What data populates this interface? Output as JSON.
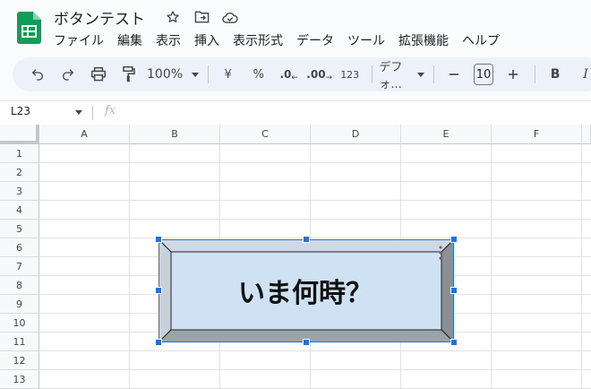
{
  "app": {
    "doc_title": "ボタンテスト",
    "menu": [
      "ファイル",
      "編集",
      "表示",
      "挿入",
      "表示形式",
      "データ",
      "ツール",
      "拡張機能",
      "ヘルプ"
    ]
  },
  "toolbar": {
    "zoom": "100%",
    "currency": "¥",
    "percent": "%",
    "decrease_decimal": ".0",
    "increase_decimal": ".00",
    "number_format": "123",
    "font": "デフォ...",
    "font_size": "10",
    "bold": "B",
    "italic": "I"
  },
  "formula_bar": {
    "name_box": "L23",
    "fx": "fx"
  },
  "grid": {
    "columns": [
      "A",
      "B",
      "C",
      "D",
      "E",
      "F"
    ],
    "rows": [
      "1",
      "2",
      "3",
      "4",
      "5",
      "6",
      "7",
      "8",
      "9",
      "10",
      "11",
      "12",
      "13"
    ]
  },
  "drawing": {
    "label": "いま何時？",
    "face_color": "#cfe2f3",
    "bevel_light": "#d0d8e4",
    "bevel_dark": "#8a9096",
    "selection_color": "#1a73e8"
  },
  "icons": {
    "logo": "google-sheets-logo",
    "star": "star-icon",
    "move": "folder-move-icon",
    "cloud": "cloud-done-icon",
    "undo": "undo-icon",
    "redo": "redo-icon",
    "print": "print-icon",
    "paint_format": "paint-format-icon",
    "minus": "minus-icon",
    "plus": "plus-icon"
  }
}
